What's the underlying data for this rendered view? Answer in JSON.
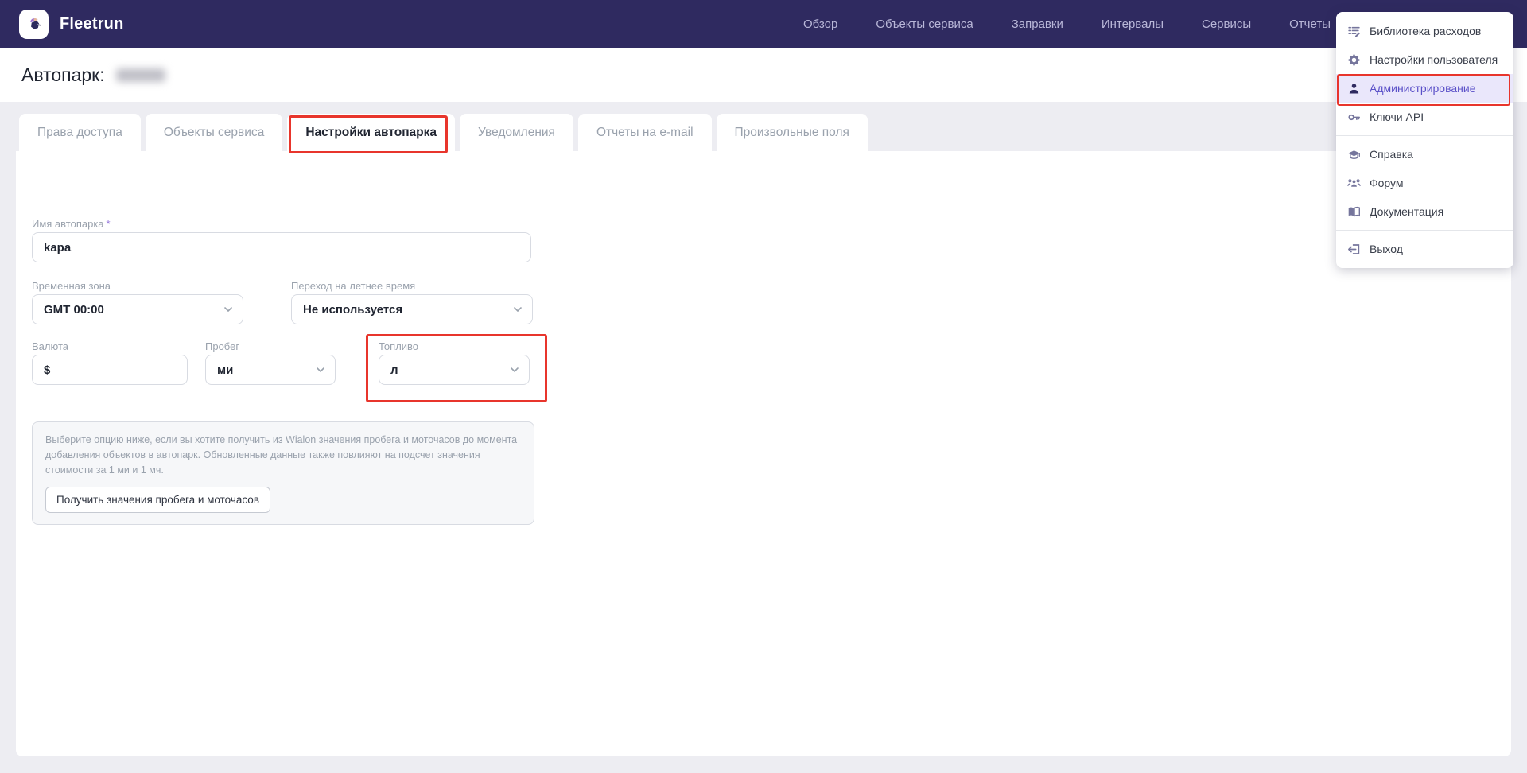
{
  "navbar": {
    "brand": "Fleetrun",
    "links": [
      {
        "label": "Обзор"
      },
      {
        "label": "Объекты сервиса"
      },
      {
        "label": "Заправки"
      },
      {
        "label": "Интервалы"
      },
      {
        "label": "Сервисы"
      },
      {
        "label": "Отчеты"
      }
    ]
  },
  "page": {
    "title_label": "Автопарк:"
  },
  "tabs": [
    {
      "label": "Права доступа",
      "active": false
    },
    {
      "label": "Объекты сервиса",
      "active": false
    },
    {
      "label": "Настройки автопарка",
      "active": true
    },
    {
      "label": "Уведомления",
      "active": false
    },
    {
      "label": "Отчеты на e-mail",
      "active": false
    },
    {
      "label": "Произвольные поля",
      "active": false
    }
  ],
  "form": {
    "name": {
      "label": "Имя автопарка",
      "required_mark": "*",
      "value": "kapa"
    },
    "timezone": {
      "label": "Временная зона",
      "value": "GMT 00:00"
    },
    "dst": {
      "label": "Переход на летнее время",
      "value": "Не используется"
    },
    "currency": {
      "label": "Валюта",
      "value": "$"
    },
    "mileage": {
      "label": "Пробег",
      "value": "ми"
    },
    "fuel": {
      "label": "Топливо",
      "value": "л"
    },
    "info": {
      "text": "Выберите опцию ниже, если вы хотите получить из Wialon значения пробега и моточасов до момента добавления объектов в автопарк. Обновленные данные также повлияют на подсчет значения стоимости за 1 ми и 1 мч.",
      "button_label": "Получить значения пробега и моточасов"
    }
  },
  "user_menu": {
    "items": [
      {
        "label": "Библиотека расходов",
        "icon": "expense-library-icon",
        "active": false
      },
      {
        "label": "Настройки пользователя",
        "icon": "gear-icon",
        "active": false
      },
      {
        "label": "Администрирование",
        "icon": "person-icon",
        "active": true
      },
      {
        "label": "Ключи API",
        "icon": "key-icon",
        "active": false
      },
      {
        "label": "Справка",
        "icon": "graduation-cap-icon",
        "active": false
      },
      {
        "label": "Форум",
        "icon": "people-icon",
        "active": false
      },
      {
        "label": "Документация",
        "icon": "book-icon",
        "active": false
      },
      {
        "label": "Выход",
        "icon": "logout-icon",
        "active": false
      }
    ]
  },
  "colors": {
    "navbar_bg": "#2f2a60",
    "page_bg": "#ededf2",
    "accent_purple": "#5a50c8",
    "annotation_red": "#e8352c",
    "menu_active_bg": "#eae7fb",
    "label_gray": "#9aa2ad"
  }
}
